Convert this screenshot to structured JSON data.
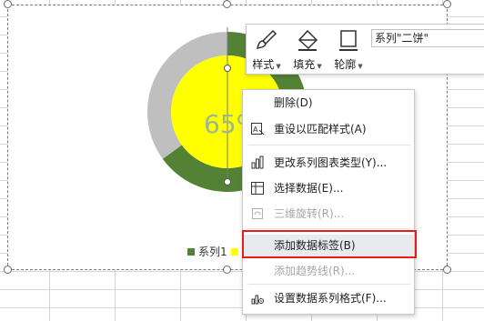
{
  "chart": {
    "center_label": "65%",
    "legend": [
      {
        "name": "系列1",
        "color": "#548235"
      },
      {
        "name": "",
        "color": "#ffff00"
      }
    ],
    "colors": {
      "outer_primary": "#548235",
      "outer_secondary": "#bfbfbf",
      "inner": "#ffff00",
      "center_text": "#9bb98a"
    }
  },
  "chart_data": {
    "type": "pie",
    "rings": [
      {
        "name": "outer",
        "values": [
          65,
          35
        ],
        "colors": [
          "#548235",
          "#bfbfbf"
        ]
      },
      {
        "name": "inner",
        "values": [
          100
        ],
        "colors": [
          "#ffff00"
        ]
      }
    ],
    "center_label": "65%"
  },
  "toolbar": {
    "style_label": "样式",
    "fill_label": "填充",
    "outline_label": "轮廓",
    "series_value": "系列\"二饼\""
  },
  "context_menu": {
    "delete": "删除(D)",
    "reset_style": "重设以匹配样式(A)",
    "change_type": "更改系列图表类型(Y)...",
    "select_data": "选择数据(E)...",
    "rotate_3d": "三维旋转(R)...",
    "add_data_labels": "添加数据标签(B)",
    "add_trendline": "添加趋势线(R)...",
    "format_series": "设置数据系列格式(F)..."
  }
}
